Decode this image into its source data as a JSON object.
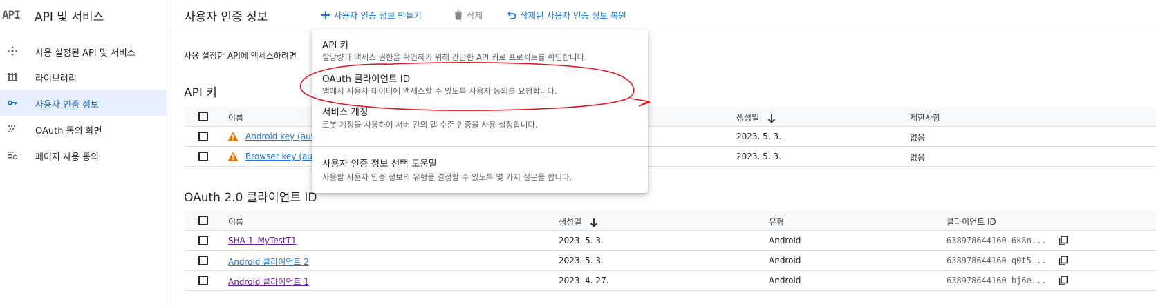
{
  "sidebar": {
    "logo": "API",
    "title": "API 및 서비스",
    "items": [
      {
        "label": "사용 설정된 API 및 서비스",
        "icon": "diamond-arrows-icon"
      },
      {
        "label": "라이브러리",
        "icon": "library-icon"
      },
      {
        "label": "사용자 인증 정보",
        "icon": "key-icon"
      },
      {
        "label": "OAuth 동의 화면",
        "icon": "consent-screen-icon"
      },
      {
        "label": "페이지 사용 동의",
        "icon": "page-usage-icon"
      }
    ]
  },
  "header": {
    "title": "사용자 인증 정보",
    "create_label": "사용자 인증 정보 만들기",
    "delete_label": "삭제",
    "restore_label": "삭제된 사용자 인증 정보 복원"
  },
  "main": {
    "description": "사용 설정한 API에 액세스하려면",
    "api_keys": {
      "title": "API 키",
      "columns": {
        "name": "이름",
        "created": "생성일",
        "restrictions": "제한사항"
      },
      "rows": [
        {
          "name": "Android key (aut",
          "created": "2023. 5. 3.",
          "restrictions": "없음"
        },
        {
          "name": "Browser key (aut",
          "created": "2023. 5. 3.",
          "restrictions": "없음"
        }
      ]
    },
    "oauth": {
      "title": "OAuth 2.0 클라이언트 ID",
      "columns": {
        "name": "이름",
        "created": "생성일",
        "type": "유형",
        "client_id": "클라이언트 ID"
      },
      "rows": [
        {
          "name": "SHA-1_MyTestT1",
          "created": "2023. 5. 3.",
          "type": "Android",
          "client_id": "638978644160-6k8n..."
        },
        {
          "name": "Android 클라이언트 2",
          "created": "2023. 5. 3.",
          "type": "Android",
          "client_id": "638978644160-q0t5..."
        },
        {
          "name": "Android 클라이언트 1",
          "created": "2023. 4. 27.",
          "type": "Android",
          "client_id": "638978644160-bj6e..."
        }
      ]
    }
  },
  "menu": {
    "items": [
      {
        "title": "API 키",
        "desc": "할당량과 액세스 권한을 확인하기 위해 간단한 API 키로 프로젝트를 확인합니다."
      },
      {
        "title": "OAuth 클라이언트 ID",
        "desc": "앱에서 사용자 데이터에 액세스할 수 있도록 사용자 동의를 요청합니다."
      },
      {
        "title": "서비스 계정",
        "desc": "로봇 계정을 사용하여 서버 간의 앱 수준 인증을 사용 설정합니다."
      },
      {
        "title": "사용자 인증 정보 선택 도움말",
        "desc": "사용할 사용자 인증 정보의 유형을 결정할 수 있도록 몇 가지 질문을 합니다."
      }
    ]
  },
  "colors": {
    "accent": "#1a73e8",
    "active_bg": "#e8f0fe",
    "warning": "#e37400",
    "annotation": "#e0141c"
  }
}
